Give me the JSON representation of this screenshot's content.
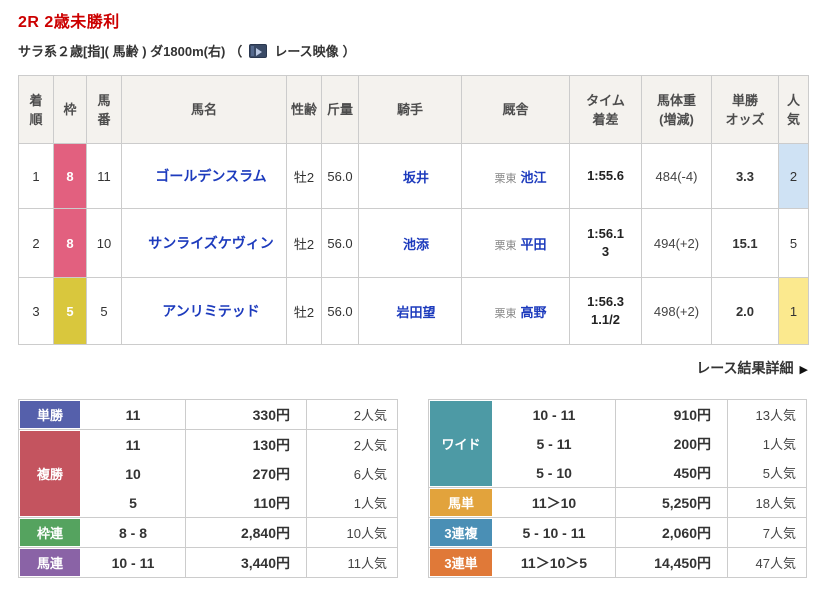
{
  "header": {
    "race_title": "2R 2歳未勝利",
    "race_conditions": "サラ系２歳[指]( 馬齢 ) ダ1800m(右)",
    "video_open": "（",
    "video_label": "レース映像",
    "video_close": "）"
  },
  "colors": {
    "title_red": "#cc0000",
    "link_blue": "#1d3bbd",
    "waku8": "#e2607f",
    "waku5": "#d9c73d",
    "pop1_bg": "#fbe98e",
    "pop2_bg": "#cfe2f4",
    "tansho": "#5560ab",
    "fukusho": "#c4545f",
    "wakuren": "#55a35f",
    "umaren": "#8a63a6",
    "wide": "#4d9aa5",
    "umatan": "#e2a33c",
    "sanrenpuku": "#4a8fb5",
    "sanrentan": "#e07938"
  },
  "results": {
    "columns": {
      "rank": "着\n順",
      "frame": "枠",
      "number": "馬\n番",
      "horse": "馬名",
      "sex_age": "性齢",
      "weight": "斤量",
      "jockey": "騎手",
      "stable": "厩舎",
      "time": "タイム\n着差",
      "horse_weight": "馬体重\n(増減)",
      "odds": "単勝\nオッズ",
      "popularity": "人\n気"
    },
    "rows": [
      {
        "rank": "1",
        "frame": "8",
        "number": "11",
        "horse": "ゴールデンスラム",
        "sex_age": "牡2",
        "weight": "56.0",
        "jockey": "坂井",
        "region": "栗東",
        "trainer": "池江",
        "time": "1:55.6",
        "margin": "",
        "horse_weight": "484(-4)",
        "odds": "3.3",
        "popularity": "2"
      },
      {
        "rank": "2",
        "frame": "8",
        "number": "10",
        "horse": "サンライズケヴィン",
        "sex_age": "牡2",
        "weight": "56.0",
        "jockey": "池添",
        "region": "栗東",
        "trainer": "平田",
        "time": "1:56.1",
        "margin": "3",
        "horse_weight": "494(+2)",
        "odds": "15.1",
        "popularity": "5"
      },
      {
        "rank": "3",
        "frame": "5",
        "number": "5",
        "horse": "アンリミテッド",
        "sex_age": "牡2",
        "weight": "56.0",
        "jockey": "岩田望",
        "region": "栗東",
        "trainer": "高野",
        "time": "1:56.3",
        "margin": "1.1/2",
        "horse_weight": "498(+2)",
        "odds": "2.0",
        "popularity": "1"
      }
    ]
  },
  "detail_link": {
    "label": "レース結果詳細",
    "arrow": "▶"
  },
  "payouts_left": {
    "groups": [
      {
        "label": "単勝",
        "color": "#5560ab",
        "rows": [
          {
            "comb": "11",
            "amount": "330円",
            "pop": "2人気"
          }
        ]
      },
      {
        "label": "複勝",
        "color": "#c4545f",
        "rows": [
          {
            "comb": "11",
            "amount": "130円",
            "pop": "2人気"
          },
          {
            "comb": "10",
            "amount": "270円",
            "pop": "6人気"
          },
          {
            "comb": "5",
            "amount": "110円",
            "pop": "1人気"
          }
        ]
      },
      {
        "label": "枠連",
        "color": "#55a35f",
        "rows": [
          {
            "comb": "8 - 8",
            "amount": "2,840円",
            "pop": "10人気"
          }
        ]
      },
      {
        "label": "馬連",
        "color": "#8a63a6",
        "rows": [
          {
            "comb": "10 - 11",
            "amount": "3,440円",
            "pop": "11人気"
          }
        ]
      }
    ]
  },
  "payouts_right": {
    "groups": [
      {
        "label": "ワイド",
        "color": "#4d9aa5",
        "rows": [
          {
            "comb": "10 - 11",
            "amount": "910円",
            "pop": "13人気"
          },
          {
            "comb": "5 - 11",
            "amount": "200円",
            "pop": "1人気"
          },
          {
            "comb": "5 - 10",
            "amount": "450円",
            "pop": "5人気"
          }
        ]
      },
      {
        "label": "馬単",
        "color": "#e2a33c",
        "rows": [
          {
            "comb": "11＞10",
            "amount": "5,250円",
            "pop": "18人気"
          }
        ]
      },
      {
        "label": "3連複",
        "color": "#4a8fb5",
        "rows": [
          {
            "comb": "5 - 10 - 11",
            "amount": "2,060円",
            "pop": "7人気"
          }
        ]
      },
      {
        "label": "3連単",
        "color": "#e07938",
        "rows": [
          {
            "comb": "11＞10＞5",
            "amount": "14,450円",
            "pop": "47人気"
          }
        ]
      }
    ]
  }
}
